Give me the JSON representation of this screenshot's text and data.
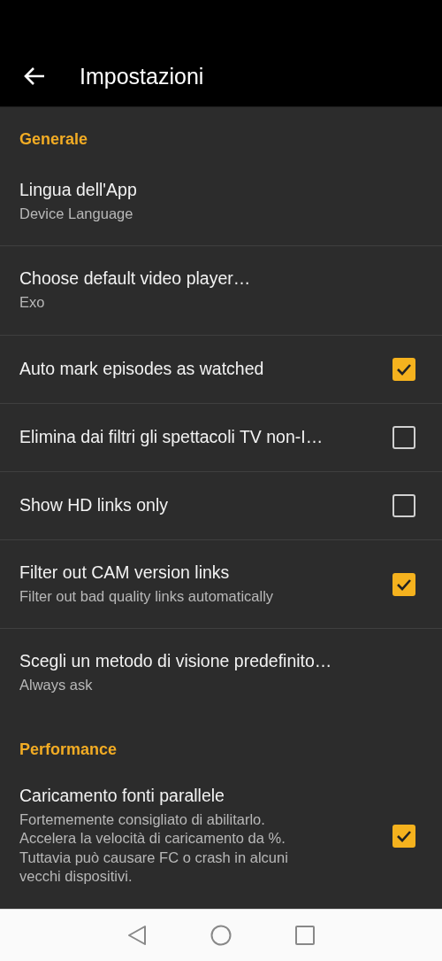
{
  "app_bar": {
    "title": "Impostazioni"
  },
  "sections": [
    {
      "header": "Generale",
      "items": [
        {
          "kind": "list",
          "title": "Lingua dell'App",
          "summary": "Device Language"
        },
        {
          "kind": "list",
          "title": "Choose default video player…",
          "summary": "Exo"
        },
        {
          "kind": "checkbox",
          "title": "Auto mark episodes as watched",
          "checked": true
        },
        {
          "kind": "checkbox",
          "title": "Elimina dai filtri gli spettacoli TV non-I…",
          "checked": false
        },
        {
          "kind": "checkbox",
          "title": "Show HD links only",
          "checked": false
        },
        {
          "kind": "checkbox",
          "title": "Filter out CAM version links",
          "summary": "Filter out bad quality links automatically",
          "checked": true
        },
        {
          "kind": "list",
          "title": "Scegli un metodo di visione predefinito…",
          "summary": "Always ask"
        }
      ]
    },
    {
      "header": "Performance",
      "items": [
        {
          "kind": "checkbox",
          "title": "Caricamento fonti parallele",
          "summary": "Fortememente consigliato di abilitarlo.\nAccelera la velocità di caricamento da %.\nTuttavia può causare FC o crash in alcuni\nvecchi dispositivi.",
          "checked": true
        }
      ]
    }
  ]
}
